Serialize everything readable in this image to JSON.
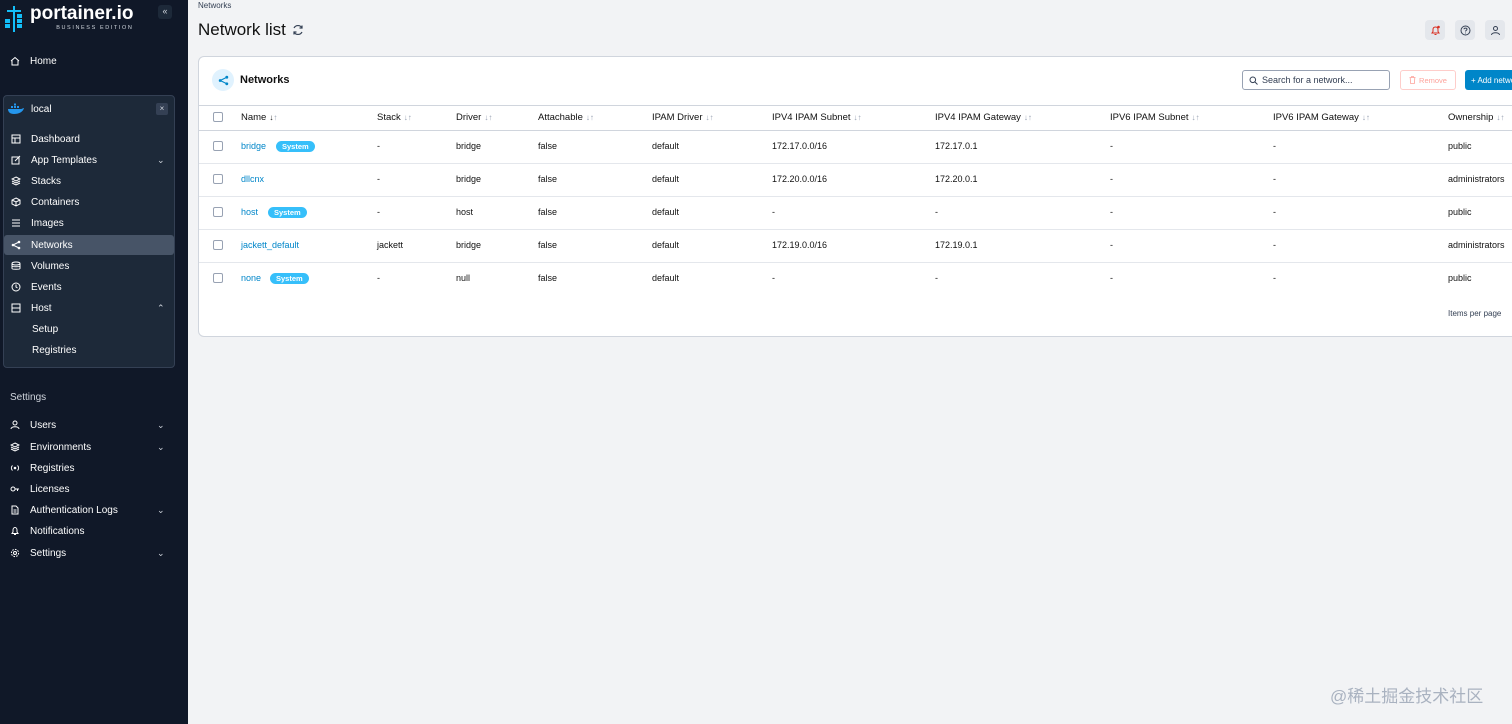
{
  "sidebar": {
    "logo_main": "portainer.io",
    "logo_sub": "BUSINESS EDITION",
    "collapse_label": "«",
    "home": "Home",
    "environment": {
      "name": "local",
      "close": "×"
    },
    "env_items": {
      "dashboard": "Dashboard",
      "app_templates": "App Templates",
      "stacks": "Stacks",
      "containers": "Containers",
      "images": "Images",
      "networks": "Networks",
      "volumes": "Volumes",
      "events": "Events",
      "host": "Host",
      "setup": "Setup",
      "registries": "Registries"
    },
    "settings_section": "Settings",
    "settings_items": {
      "users": "Users",
      "environments": "Environments",
      "registries": "Registries",
      "licenses": "Licenses",
      "auth_logs": "Authentication Logs",
      "notifications": "Notifications",
      "settings": "Settings"
    }
  },
  "header": {
    "breadcrumb": "Networks",
    "title": "Network list"
  },
  "panel": {
    "title": "Networks",
    "search_placeholder": "Search for a network...",
    "remove_label": "Remove",
    "add_label": "+ Add network"
  },
  "table": {
    "columns": {
      "name": "Name",
      "stack": "Stack",
      "driver": "Driver",
      "attachable": "Attachable",
      "ipam_driver": "IPAM Driver",
      "ipv4_subnet": "IPV4 IPAM Subnet",
      "ipv4_gateway": "IPV4 IPAM Gateway",
      "ipv6_subnet": "IPV6 IPAM Subnet",
      "ipv6_gateway": "IPV6 IPAM Gateway",
      "ownership": "Ownership"
    },
    "badge_label": "System",
    "rows": [
      {
        "name": "bridge",
        "system": true,
        "stack": "-",
        "driver": "bridge",
        "attachable": "false",
        "ipam_driver": "default",
        "ipv4_subnet": "172.17.0.0/16",
        "ipv4_gateway": "172.17.0.1",
        "ipv6_subnet": "-",
        "ipv6_gateway": "-",
        "ownership": "public"
      },
      {
        "name": "dllcnx",
        "system": false,
        "stack": "-",
        "driver": "bridge",
        "attachable": "false",
        "ipam_driver": "default",
        "ipv4_subnet": "172.20.0.0/16",
        "ipv4_gateway": "172.20.0.1",
        "ipv6_subnet": "-",
        "ipv6_gateway": "-",
        "ownership": "administrators"
      },
      {
        "name": "host",
        "system": true,
        "stack": "-",
        "driver": "host",
        "attachable": "false",
        "ipam_driver": "default",
        "ipv4_subnet": "-",
        "ipv4_gateway": "-",
        "ipv6_subnet": "-",
        "ipv6_gateway": "-",
        "ownership": "public"
      },
      {
        "name": "jackett_default",
        "system": false,
        "stack": "jackett",
        "driver": "bridge",
        "attachable": "false",
        "ipam_driver": "default",
        "ipv4_subnet": "172.19.0.0/16",
        "ipv4_gateway": "172.19.0.1",
        "ipv6_subnet": "-",
        "ipv6_gateway": "-",
        "ownership": "administrators"
      },
      {
        "name": "none",
        "system": true,
        "stack": "-",
        "driver": "null",
        "attachable": "false",
        "ipam_driver": "default",
        "ipv4_subnet": "-",
        "ipv4_gateway": "-",
        "ipv6_subnet": "-",
        "ipv6_gateway": "-",
        "ownership": "public"
      }
    ],
    "items_per_page_label": "Items per page"
  },
  "watermark": "@稀土掘金技术社区",
  "colors": {
    "sidebar_bg": "#101828",
    "accent": "#0086c9",
    "badge": "#36bffa"
  }
}
